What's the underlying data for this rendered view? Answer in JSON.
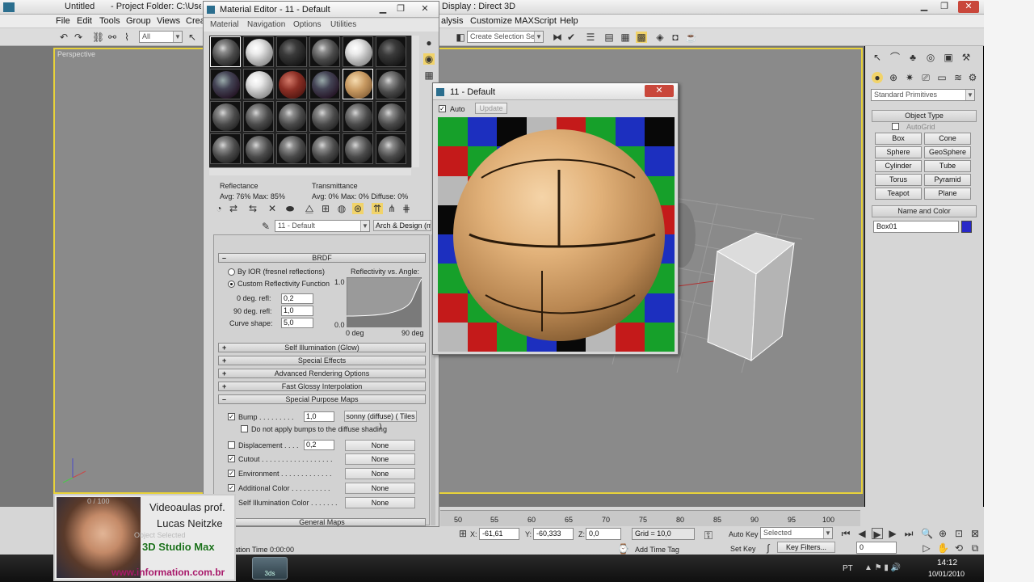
{
  "main_window": {
    "title_left": "Untitled",
    "project": "- Project Folder: C:\\Users\\N",
    "title_right": "Display : Direct 3D"
  },
  "menu": [
    "File",
    "Edit",
    "Tools",
    "Group",
    "Views",
    "Crea"
  ],
  "menu_right": [
    "alysis",
    "Customize",
    "MAXScript",
    "Help"
  ],
  "selection_filter": "All",
  "selection_set_placeholder": "Create Selection Set",
  "viewport": {
    "label": "Perspective"
  },
  "material_editor": {
    "title": "Material Editor - 11 - Default",
    "menus": [
      "Material",
      "Navigation",
      "Options",
      "Utilities"
    ],
    "reflectance_label": "Reflectance",
    "reflectance_values": "Avg:  76% Max:  85%",
    "transmittance_label": "Transmittance",
    "transmittance_values": "Avg:   0% Max:   0%  Diffuse:   0%",
    "material_name": "11 - Default",
    "material_type": "Arch & Design (mi)",
    "brdf": {
      "title": "BRDF",
      "by_ior": "By IOR (fresnel reflections)",
      "custom": "Custom Reflectivity Function",
      "graph_title": "Reflectivity vs. Angle:",
      "zero_deg_label": "0 deg. refl:",
      "zero_deg_value": "0,2",
      "ninety_deg_label": "90 deg. refl:",
      "ninety_deg_value": "1,0",
      "curve_label": "Curve shape:",
      "curve_value": "5,0",
      "y_max": "1.0",
      "y_min": "0.0",
      "x_min": "0 deg",
      "x_max": "90 deg"
    },
    "rollouts": [
      "Self Illumination (Glow)",
      "Special Effects",
      "Advanced Rendering Options",
      "Fast Glossy Interpolation",
      "Special Purpose Maps"
    ],
    "bump_label": "Bump . . . . . . . . .",
    "bump_value": "1,0",
    "bump_map": "sonny (diffuse)  ( Tiles )",
    "no_bump_label": "Do not apply bumps to the diffuse shading",
    "displacement_label": "Displacement . . . .",
    "displacement_value": "0,2",
    "cutout_label": "Cutout . . . . . . . . . . . . . . . . . .",
    "environment_label": "Environment . . . . . . . . . . . . .",
    "additional_color_label": "Additional Color  . . . . . . . . . .",
    "self_illum_label": "Self Illumination Color . . . . . . .",
    "none_label": "None",
    "general_maps": "General Maps"
  },
  "preview_window": {
    "title": "11 - Default",
    "auto_label": "Auto",
    "update_label": "Update"
  },
  "command_panel": {
    "category": "Standard Primitives",
    "object_type": "Object Type",
    "autogrid": "AutoGrid",
    "buttons": [
      "Box",
      "Cone",
      "Sphere",
      "GeoSphere",
      "Cylinder",
      "Tube",
      "Torus",
      "Pyramid",
      "Teapot",
      "Plane"
    ],
    "name_and_color": "Name and Color",
    "object_name": "Box01",
    "object_color": "#2828c8"
  },
  "timeline": {
    "ticks": [
      "50",
      "55",
      "60",
      "65",
      "70",
      "75",
      "80",
      "85",
      "90",
      "95",
      "100"
    ]
  },
  "status": {
    "x_value": "-61,61",
    "y_value": "-60,333",
    "z_value": "0,0",
    "grid": "Grid = 10,0",
    "auto_key": "Auto Key",
    "selected": "Selected",
    "set_key": "Set Key",
    "key_filters": "Key Filters...",
    "frame": "0",
    "add_time_tag": "Add Time Tag",
    "time_text": "ation Time  0:00:00",
    "x_label": "X:",
    "y_label": "Y:",
    "z_label": "Z:"
  },
  "taskbar": {
    "lang": "PT",
    "time": "14:12",
    "date": "10/01/2010",
    "app_icon": "3ds"
  },
  "webcam": {
    "line1": "Videoaulas prof.",
    "line2": "Lucas Neitzke",
    "line3": "3D Studio Max",
    "url": "www.information.com.br",
    "faint_counter": "0 / 100",
    "faint_status": "Object Selected"
  }
}
